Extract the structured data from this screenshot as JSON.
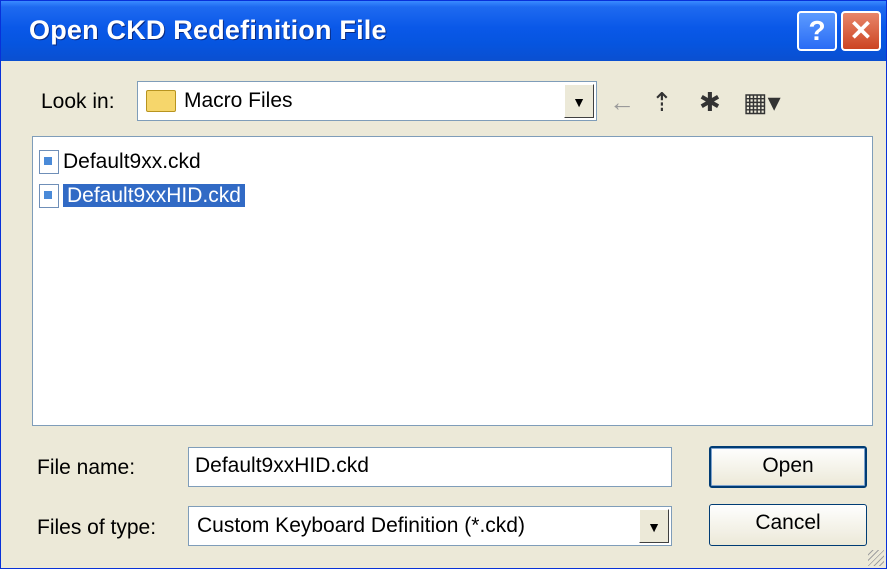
{
  "window": {
    "title": "Open CKD Redefinition File",
    "help_label": "?",
    "close_label": "✕"
  },
  "look_in": {
    "label": "Look in:",
    "value": "Macro Files"
  },
  "toolbar": {
    "back_icon": "←",
    "up_icon": "⇡",
    "new_folder_icon": "✱",
    "views_icon": "▦▾"
  },
  "files": [
    {
      "name": "Default9xx.ckd",
      "selected": false
    },
    {
      "name": "Default9xxHID.ckd",
      "selected": true
    }
  ],
  "file_name": {
    "label": "File name:",
    "value": "Default9xxHID.ckd"
  },
  "file_type": {
    "label": "Files of type:",
    "value": "Custom Keyboard Definition (*.ckd)"
  },
  "buttons": {
    "open_label": "Open",
    "cancel_label": "Cancel"
  }
}
